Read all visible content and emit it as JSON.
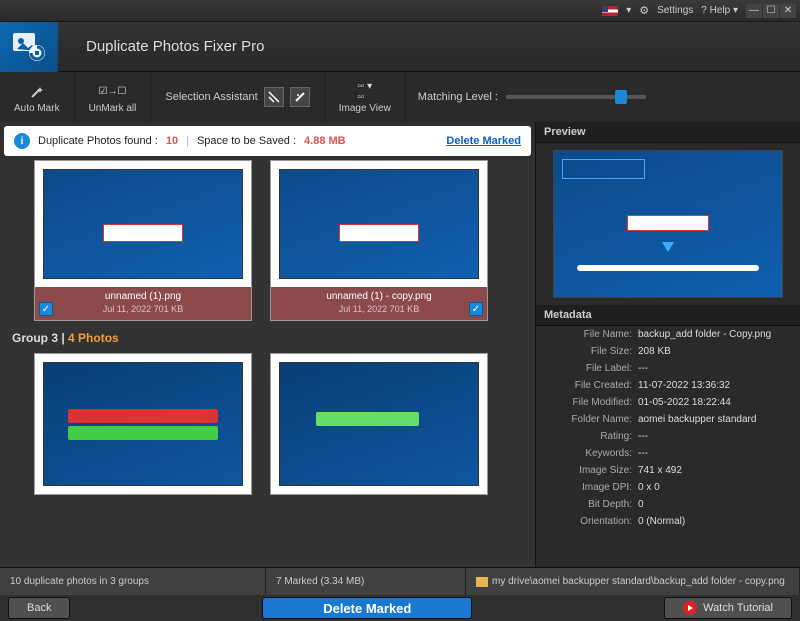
{
  "titlebar": {
    "settings": "Settings",
    "help": "Help",
    "lang_dropdown": "▾"
  },
  "app": {
    "title": "Duplicate Photos Fixer Pro"
  },
  "toolbar": {
    "auto_mark": "Auto Mark",
    "unmark_all": "UnMark all",
    "selection_assistant": "Selection Assistant",
    "image_view": "Image View",
    "matching_level": "Matching Level :",
    "matching_level_pct": 78
  },
  "info": {
    "found_label": "Duplicate Photos found :",
    "found_count": "10",
    "space_label": "Space to be Saved :",
    "space_value": "4.88 MB",
    "delete_marked": "Delete Marked"
  },
  "group2": {
    "items": [
      {
        "name": "unnamed (1).png",
        "meta": "Jul 11, 2022   701 KB"
      },
      {
        "name": "unnamed (1) - copy.png",
        "meta": "Jul 11, 2022   701 KB"
      }
    ]
  },
  "group3": {
    "label_prefix": "Group 3  |  ",
    "count": "4",
    "label_suffix": " Photos"
  },
  "preview": {
    "title": "Preview"
  },
  "metadata": {
    "title": "Metadata",
    "rows": [
      {
        "lbl": "File Name:",
        "val": "backup_add folder - Copy.png"
      },
      {
        "lbl": "File Size:",
        "val": "208 KB"
      },
      {
        "lbl": "File Label:",
        "val": "---"
      },
      {
        "lbl": "File Created:",
        "val": "11-07-2022 13:36:32"
      },
      {
        "lbl": "File Modified:",
        "val": "01-05-2022 18:22:44"
      },
      {
        "lbl": "Folder Name:",
        "val": "aomei backupper standard"
      },
      {
        "lbl": "Rating:",
        "val": "---"
      },
      {
        "lbl": "Keywords:",
        "val": "---"
      },
      {
        "lbl": "Image Size:",
        "val": "741 x 492"
      },
      {
        "lbl": "Image DPI:",
        "val": "0 x 0"
      },
      {
        "lbl": "Bit Depth:",
        "val": "0"
      },
      {
        "lbl": "Orientation:",
        "val": "0 (Normal)"
      }
    ]
  },
  "status": {
    "left": "10 duplicate photos in 3 groups",
    "mid": "7 Marked (3.34 MB)",
    "path": "my drive\\aomei backupper standard\\backup_add folder - copy.png"
  },
  "footer": {
    "back": "Back",
    "delete": "Delete Marked",
    "tutorial": "Watch Tutorial"
  }
}
